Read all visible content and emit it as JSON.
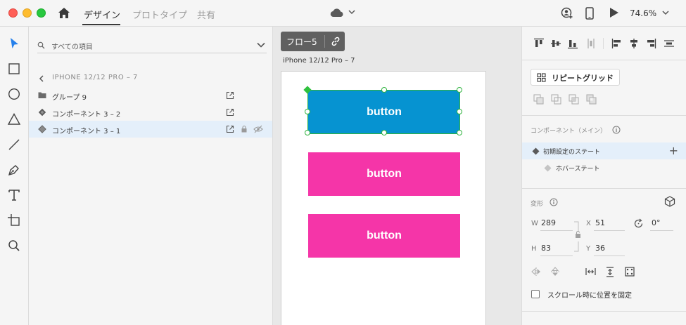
{
  "titlebar": {
    "tabs": [
      {
        "label": "デザイン",
        "active": true
      },
      {
        "label": "プロトタイプ",
        "active": false
      },
      {
        "label": "共有",
        "active": false
      }
    ],
    "zoom": "74.6%",
    "icons": [
      "home-icon",
      "cloud-icon",
      "add-user-icon",
      "device-preview-icon",
      "play-icon"
    ]
  },
  "tools": [
    "select-tool-icon",
    "rectangle-tool-icon",
    "ellipse-tool-icon",
    "polygon-tool-icon",
    "line-tool-icon",
    "pen-tool-icon",
    "text-tool-icon",
    "artboard-tool-icon",
    "zoom-tool-icon"
  ],
  "layers": {
    "search_placeholder": "すべての項目",
    "breadcrumb": "IPHONE 12/12 PRO – 7",
    "items": [
      {
        "label": "グループ 9",
        "icon": "folder-icon",
        "selected": false
      },
      {
        "label": "コンポーネント 3 – 2",
        "icon": "component-icon",
        "selected": false
      },
      {
        "label": "コンポーネント 3 – 1",
        "icon": "component-icon",
        "selected": true
      }
    ]
  },
  "canvas": {
    "flow_label": "フロー5",
    "artboard_name": "iPhone 12/12 Pro – 7",
    "buttons": [
      {
        "label": "button",
        "color": "#0693d1",
        "selected": true
      },
      {
        "label": "button",
        "color": "#f535a8",
        "selected": false
      },
      {
        "label": "button",
        "color": "#f535a8",
        "selected": false
      }
    ]
  },
  "props": {
    "repeat_grid_label": "リピートグリッド",
    "component_section": "コンポーネント（メイン）",
    "states": [
      {
        "label": "初期設定のステート",
        "selected": true
      },
      {
        "label": "ホバーステート",
        "selected": false
      }
    ],
    "transform_section": "変形",
    "fields": {
      "w_label": "W",
      "w_value": "289",
      "h_label": "H",
      "h_value": "83",
      "x_label": "X",
      "x_value": "51",
      "y_label": "Y",
      "y_value": "36",
      "rotation_value": "0°"
    },
    "fixed_scroll_label": "スクロール時に位置を固定",
    "fixed_scroll_checked": false
  },
  "colors": {
    "accent": "#2680eb",
    "selection": "#2fb33e",
    "button_blue": "#0693d1",
    "button_pink": "#f535a8"
  }
}
